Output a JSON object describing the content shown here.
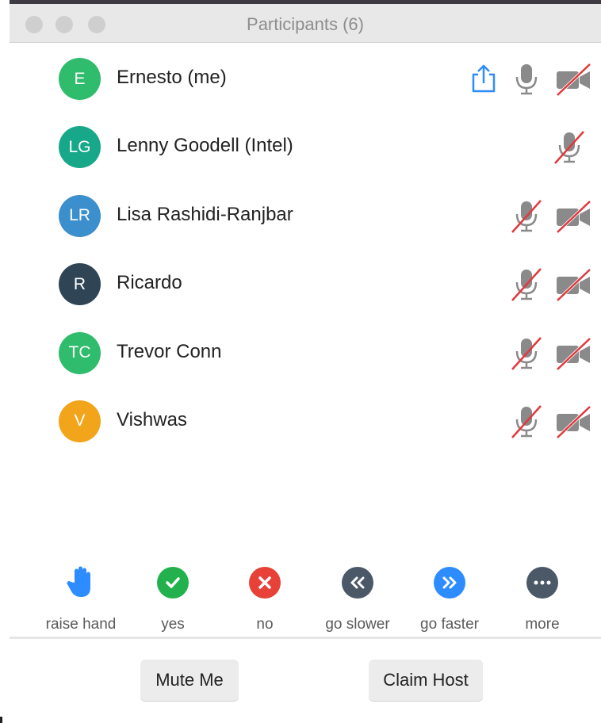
{
  "window": {
    "title": "Participants (6)",
    "traffic_lights": [
      "close",
      "minimize",
      "zoom"
    ]
  },
  "participants": [
    {
      "initials": "E",
      "name": "Ernesto (me)",
      "avatar_color": "#2fbc6c",
      "share": true,
      "mic": "on",
      "video": "off"
    },
    {
      "initials": "LG",
      "name": "Lenny Goodell (Intel)",
      "avatar_color": "#17a88a",
      "share": false,
      "mic": "muted",
      "video": "none"
    },
    {
      "initials": "LR",
      "name": "Lisa Rashidi-Ranjbar",
      "avatar_color": "#3b8fcc",
      "share": false,
      "mic": "muted",
      "video": "off"
    },
    {
      "initials": "R",
      "name": "Ricardo",
      "avatar_color": "#2f4556",
      "share": false,
      "mic": "muted",
      "video": "off"
    },
    {
      "initials": "TC",
      "name": "Trevor Conn",
      "avatar_color": "#2fbc6c",
      "share": false,
      "mic": "muted",
      "video": "off"
    },
    {
      "initials": "V",
      "name": "Vishwas",
      "avatar_color": "#f2a51a",
      "share": false,
      "mic": "muted",
      "video": "off"
    }
  ],
  "reactions": [
    {
      "label": "raise hand",
      "icon": "raise-hand-icon",
      "color": "#2d8cff"
    },
    {
      "label": "yes",
      "icon": "checkmark-icon",
      "color": "#22b14c"
    },
    {
      "label": "no",
      "icon": "x-icon",
      "color": "#e84138"
    },
    {
      "label": "go slower",
      "icon": "rewind-icon",
      "color": "#4a5868"
    },
    {
      "label": "go faster",
      "icon": "fast-forward-icon",
      "color": "#2d8cff"
    },
    {
      "label": "more",
      "icon": "more-dots-icon",
      "color": "#4a5868"
    }
  ],
  "buttons": {
    "mute_me": "Mute Me",
    "claim_host": "Claim Host"
  },
  "colors": {
    "share_blue": "#2d8cff",
    "muted_slash": "#e0393e",
    "icon_gray": "#8a8a8a"
  }
}
